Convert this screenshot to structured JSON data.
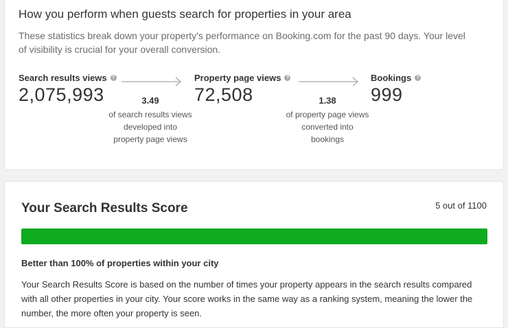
{
  "performance": {
    "title": "How you perform when guests search for properties in your area",
    "description": "These statistics break down your property's performance on Booking.com for the past 90 days. Your level of visibility is crucial for your overall conversion.",
    "metrics": [
      {
        "label": "Search results views",
        "value": "2,075,993",
        "help_icon": "question-circle"
      },
      {
        "label": "Property page views",
        "value": "72,508",
        "help_icon": "question-circle"
      },
      {
        "label": "Bookings",
        "value": "999",
        "help_icon": "question-circle"
      }
    ],
    "ratios": [
      {
        "value": "3.49",
        "description": "of search results views developed into property page views"
      },
      {
        "value": "1.38",
        "description": "of property page views converted into bookings"
      }
    ]
  },
  "score": {
    "title": "Your Search Results Score",
    "count": "5 out of 1100",
    "progress_fraction": 1.0,
    "progress_color": "#0eaa1f",
    "better_than": "Better than 100% of properties within your city",
    "description": "Your Search Results Score is based on the number of times your property appears in the search results compared with all other properties in your city. Your score works in the same way as a ranking system, meaning the lower the number, the more often your property is seen."
  }
}
